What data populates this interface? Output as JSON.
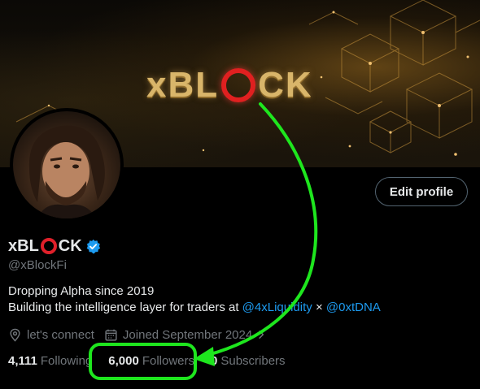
{
  "banner": {
    "logo_left": "xBL",
    "logo_right": "CK"
  },
  "profile": {
    "name_left": "xBL",
    "name_right": "CK",
    "handle": "@xBlockFi",
    "edit_button": "Edit profile",
    "bio_line1": "Dropping Alpha since 2019",
    "bio_line2_prefix": "Building the intelligence layer for traders at ",
    "mention1": "@4xLiquidity",
    "separator": " × ",
    "mention2": "@0xtDNA",
    "location": "let's connect",
    "joined": "Joined September 2024"
  },
  "stats": {
    "following_count": "4,111",
    "following_label": "Following",
    "followers_count": "6,000",
    "followers_label": "Followers",
    "subscribers_count": "0",
    "subscribers_label": "Subscribers"
  },
  "colors": {
    "accent_blue": "#1d9bf0",
    "annotation_green": "#1ee61e",
    "logo_gold": "#d9b56a",
    "logo_red": "#e02020"
  },
  "icons": [
    "verified-badge-icon",
    "location-pin-icon",
    "calendar-icon",
    "chevron-right-icon"
  ]
}
